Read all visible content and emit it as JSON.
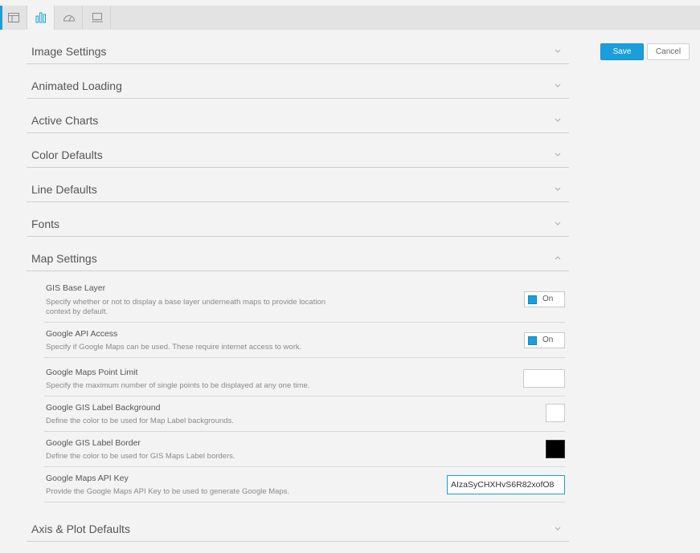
{
  "tabs": [
    {
      "icon": "table-icon"
    },
    {
      "icon": "bar-chart-icon"
    },
    {
      "icon": "gauge-icon"
    },
    {
      "icon": "monitor-icon"
    }
  ],
  "actions": {
    "save_label": "Save",
    "cancel_label": "Cancel"
  },
  "sections": [
    {
      "title": "Image Settings"
    },
    {
      "title": "Animated Loading"
    },
    {
      "title": "Active Charts"
    },
    {
      "title": "Color Defaults"
    },
    {
      "title": "Line Defaults"
    },
    {
      "title": "Fonts"
    },
    {
      "title": "Map Settings"
    },
    {
      "title": "Axis & Plot Defaults"
    }
  ],
  "map_settings": {
    "rows": [
      {
        "title": "GIS Base Layer",
        "desc": "Specify whether or not to display a base layer underneath maps to provide location context by default.",
        "value": "On"
      },
      {
        "title": "Google API Access",
        "desc": "Specify if Google Maps can be used. These require internet access to work.",
        "value": "On"
      },
      {
        "title": "Google Maps Point Limit",
        "desc": "Specify the maximum number of single points to be displayed at any one time.",
        "value": ""
      },
      {
        "title": "Google GIS Label Background",
        "desc": "Define the color to be used for Map Label backgrounds.",
        "color": "#ffffff"
      },
      {
        "title": "Google GIS Label Border",
        "desc": "Define the color to be used for GIS Maps Label borders.",
        "color": "#000000"
      },
      {
        "title": "Google Maps API Key",
        "desc": "Provide the Google Maps API Key to be used to generate Google Maps.",
        "value": "AIzaSyCHXHvS6R82xofO8"
      }
    ]
  },
  "colors": {
    "accent": "#1a9fdc"
  }
}
